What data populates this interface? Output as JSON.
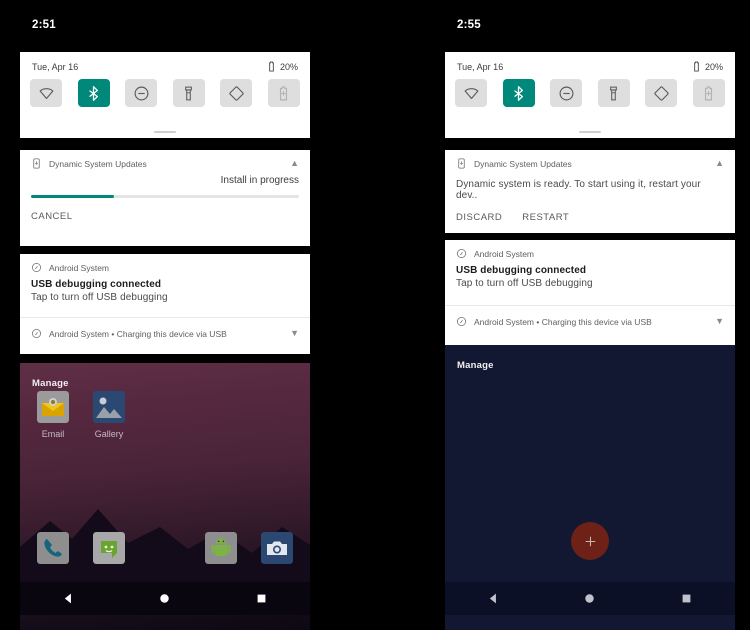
{
  "panels": [
    {
      "id": "left",
      "clock": "2:51",
      "quick_settings": {
        "date": "Tue, Apr 16",
        "battery": "20%",
        "tiles": [
          {
            "name": "wifi-tile",
            "label": "Wi-Fi",
            "state": "off"
          },
          {
            "name": "bluetooth-tile",
            "label": "Bluetooth",
            "state": "on"
          },
          {
            "name": "do-not-disturb-tile",
            "label": "Do Not Disturb",
            "state": "off"
          },
          {
            "name": "flashlight-tile",
            "label": "Flashlight",
            "state": "off"
          },
          {
            "name": "auto-rotate-tile",
            "label": "Auto-rotate",
            "state": "off"
          },
          {
            "name": "battery-saver-tile",
            "label": "Battery Saver",
            "state": "disabled"
          }
        ]
      },
      "notifications": [
        {
          "type": "progress",
          "app": "Dynamic System Updates",
          "status_text": "Install in progress",
          "progress_percent": 31,
          "actions": [
            "CANCEL"
          ],
          "chevron": "collapse"
        },
        {
          "type": "standard",
          "app": "Android System",
          "title": "USB debugging connected",
          "text": "Tap to turn off USB debugging"
        },
        {
          "type": "compact",
          "summary": "Android System • Charging this device via USB",
          "chevron": "expand"
        }
      ],
      "manage_label": "Manage",
      "home": {
        "apps": [
          {
            "name": "email-app",
            "label": "Email"
          },
          {
            "name": "gallery-app",
            "label": "Gallery"
          }
        ],
        "dock": [
          {
            "name": "phone-app",
            "label": "Phone"
          },
          {
            "name": "messaging-app",
            "label": "Messaging"
          },
          {
            "name": "android-app",
            "label": "Android"
          },
          {
            "name": "camera-app",
            "label": "Camera"
          }
        ]
      },
      "navigation": [
        "back",
        "home",
        "recents"
      ]
    },
    {
      "id": "right",
      "clock": "2:55",
      "quick_settings": {
        "date": "Tue, Apr 16",
        "battery": "20%",
        "tiles": [
          {
            "name": "wifi-tile",
            "label": "Wi-Fi",
            "state": "off"
          },
          {
            "name": "bluetooth-tile",
            "label": "Bluetooth",
            "state": "on"
          },
          {
            "name": "do-not-disturb-tile",
            "label": "Do Not Disturb",
            "state": "off"
          },
          {
            "name": "flashlight-tile",
            "label": "Flashlight",
            "state": "off"
          },
          {
            "name": "auto-rotate-tile",
            "label": "Auto-rotate",
            "state": "off"
          },
          {
            "name": "battery-saver-tile",
            "label": "Battery Saver",
            "state": "disabled"
          }
        ]
      },
      "notifications": [
        {
          "type": "message",
          "app": "Dynamic System Updates",
          "text": "Dynamic system is ready. To start using it, restart your dev..",
          "actions": [
            "DISCARD",
            "RESTART"
          ],
          "chevron": "collapse"
        },
        {
          "type": "standard",
          "app": "Android System",
          "title": "USB debugging connected",
          "text": "Tap to turn off USB debugging"
        },
        {
          "type": "compact",
          "summary": "Android System • Charging this device via USB",
          "chevron": "expand"
        }
      ],
      "manage_label": "Manage",
      "home": {
        "fab": {
          "name": "add-fab",
          "glyph": "+"
        }
      },
      "navigation": [
        "back",
        "home",
        "recents"
      ]
    }
  ],
  "colors": {
    "accent_teal": "#00897b",
    "card_white": "#ffffff",
    "tile_grey": "#dedede",
    "right_home_bg": "#121832",
    "fab_red": "#6e2116",
    "screen_black": "#000000"
  }
}
